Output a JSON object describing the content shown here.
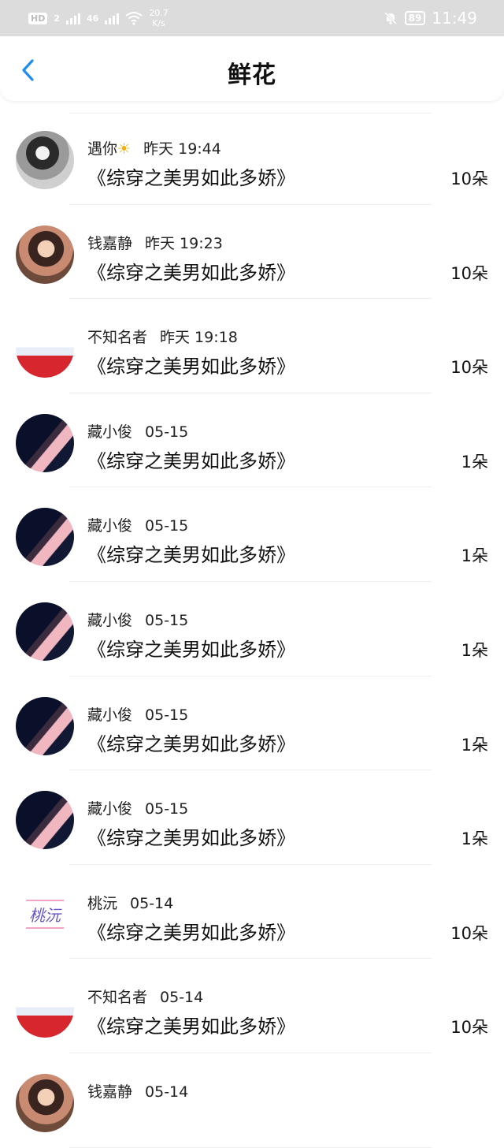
{
  "status_bar": {
    "hd": "HD",
    "sim": "2",
    "network": "46",
    "speed_value": "20.7",
    "speed_unit": "K/s",
    "battery": "89",
    "time": "11:49"
  },
  "nav": {
    "title": "鲜花",
    "back_icon": "chevron-left-icon",
    "accent": "#1e8cf0"
  },
  "items": [
    {
      "name": "遇你",
      "emoji": "☀",
      "time": "昨天 19:44",
      "book": "《综穿之美男如此多娇》",
      "count": "10朵",
      "avatar": "girl-bw"
    },
    {
      "name": "钱嘉静",
      "emoji": "",
      "time": "昨天 19:23",
      "book": "《综穿之美男如此多娇》",
      "count": "10朵",
      "avatar": "girl-color"
    },
    {
      "name": "不知名者",
      "emoji": "",
      "time": "昨天 19:18",
      "book": "《综穿之美男如此多娇》",
      "count": "10朵",
      "avatar": "anime"
    },
    {
      "name": "藏小俊",
      "emoji": "",
      "time": "05-15",
      "book": "《综穿之美男如此多娇》",
      "count": "1朵",
      "avatar": "night"
    },
    {
      "name": "藏小俊",
      "emoji": "",
      "time": "05-15",
      "book": "《综穿之美男如此多娇》",
      "count": "1朵",
      "avatar": "night"
    },
    {
      "name": "藏小俊",
      "emoji": "",
      "time": "05-15",
      "book": "《综穿之美男如此多娇》",
      "count": "1朵",
      "avatar": "night"
    },
    {
      "name": "藏小俊",
      "emoji": "",
      "time": "05-15",
      "book": "《综穿之美男如此多娇》",
      "count": "1朵",
      "avatar": "night"
    },
    {
      "name": "藏小俊",
      "emoji": "",
      "time": "05-15",
      "book": "《综穿之美男如此多娇》",
      "count": "1朵",
      "avatar": "night"
    },
    {
      "name": "桃沅",
      "emoji": "",
      "time": "05-14",
      "book": "《综穿之美男如此多娇》",
      "count": "10朵",
      "avatar": "logo",
      "logo_text": "桃沅"
    },
    {
      "name": "不知名者",
      "emoji": "",
      "time": "05-14",
      "book": "《综穿之美男如此多娇》",
      "count": "10朵",
      "avatar": "anime"
    },
    {
      "name": "钱嘉静",
      "emoji": "",
      "time": "05-14",
      "book": "",
      "count": "",
      "avatar": "girl-color"
    }
  ]
}
